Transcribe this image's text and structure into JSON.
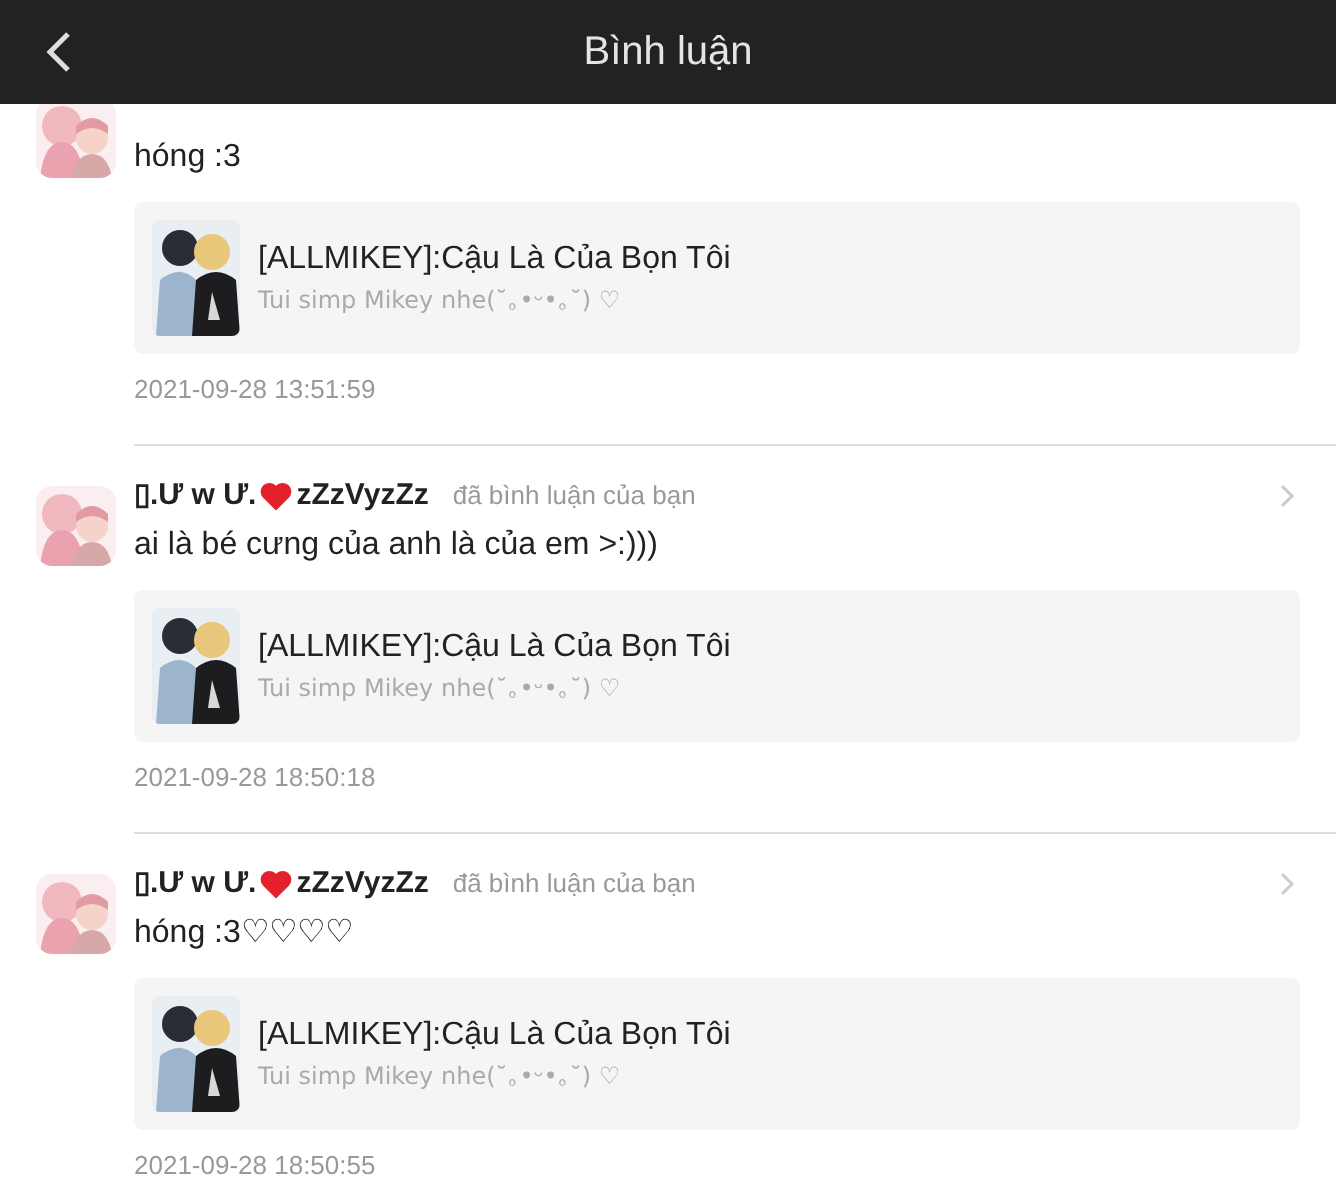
{
  "header": {
    "title": "Bình luận"
  },
  "comments": [
    {
      "text": "hóng :3",
      "work": {
        "title": "[ALLMIKEY]:Cậu Là Của Bọn Tôi",
        "description": "Tui simp Mikey nhe(˘｡•ᵕ•｡˘) ♡"
      },
      "time": "2021-09-28 13:51:59"
    },
    {
      "author_before": "▯.Ư w Ư.",
      "author_after": "zZzVyzZz",
      "action": "đã bình luận của bạn",
      "text": "ai là bé cưng của anh là của em >:)))",
      "work": {
        "title": "[ALLMIKEY]:Cậu Là Của Bọn Tôi",
        "description": "Tui simp Mikey nhe(˘｡•ᵕ•｡˘) ♡"
      },
      "time": "2021-09-28 18:50:18"
    },
    {
      "author_before": "▯.Ư w Ư.",
      "author_after": "zZzVyzZz",
      "action": "đã bình luận của bạn",
      "text": "hóng :3♡♡♡♡",
      "work": {
        "title": "[ALLMIKEY]:Cậu Là Của Bọn Tôi",
        "description": "Tui simp Mikey nhe(˘｡•ᵕ•｡˘) ♡"
      },
      "time": "2021-09-28 18:50:55"
    }
  ]
}
